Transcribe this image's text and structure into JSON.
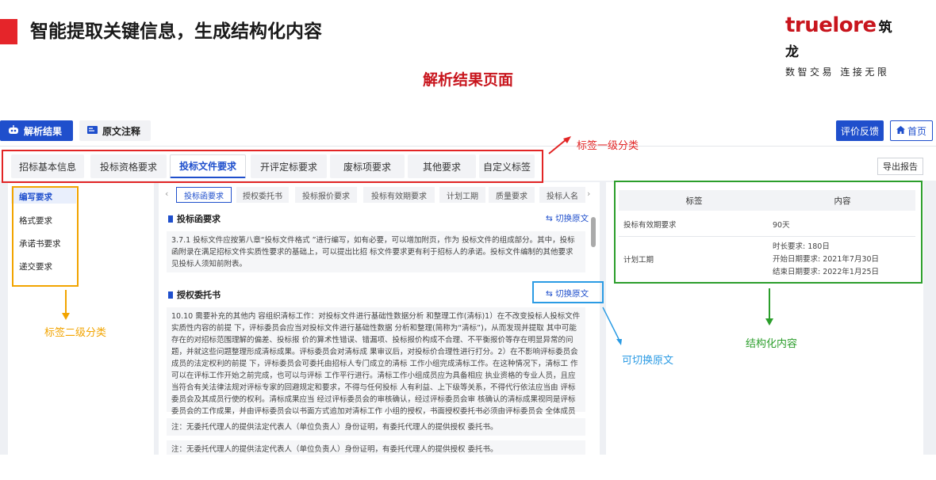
{
  "slide": {
    "title": "智能提取关键信息，生成结构化内容",
    "logo_main": "truelore",
    "logo_cn": "筑龙",
    "logo_sub": "数智交易 连接无限",
    "heading": "解析结果页面"
  },
  "topbar": {
    "parse_label": "解析结果",
    "annot_label": "原文注释",
    "feedback_label": "评价反馈",
    "home_label": "首页"
  },
  "tabs": [
    "招标基本信息",
    "投标资格要求",
    "投标文件要求",
    "开评定标要求",
    "废标项要求",
    "其他要求",
    "自定义标签"
  ],
  "export_label": "导出报告",
  "sidebar": [
    "编写要求",
    "格式要求",
    "承诺书要求",
    "递交要求"
  ],
  "subtabs": [
    "投标函要求",
    "授权委托书",
    "投标报价要求",
    "投标有效期要求",
    "计划工期",
    "质量要求",
    "投标人名"
  ],
  "sections": {
    "s1_title": "投标函要求",
    "s1_text": "3.7.1 投标文件应按第八章“投标文件格式 ”进行编写，如有必要，可以增加附页，作为 投标文件的组成部分。其中，投标函附录在满足招标文件实质性要求的基础上，可以提出比招 标文件要求更有利于招标人的承诺。投标文件编制的其他要求见投标人须知前附表。",
    "s2_title": "授权委托书",
    "s2_text": "10.10 需要补充的其他内 容组织清标工作：对投标文件进行基础性数据分析 和整理工作(清标)1）在不改变投标人投标文件实质性内容的前提 下，评标委员会应当对投标文件进行基础性数据 分析和整理(简称为“清标”)，从而发现并提取 其中可能存在的对招标范围理解的偏差、投标报 价的算术性错误、错漏项、投标报价构成不合理、不平衡报价等存在明显异常的问题，并就这些问题整理形成清标成果。评标委员会对清标成 果审议后，对投标价合理性进行打分。2）在不影响评标委员会成员的法定权利的前提 下，评标委员会可委托由招标人专门成立的清标 工作小组完成清标工作。在这种情况下，清标工 作可以在评标工作开始之前完成，也可以与评标 工作平行进行。清标工作小组成员应为具备相应 执业资格的专业人员，且应当符合有关法律法规对评标专家的回避规定和要求，不得与任何投标 人有利益、上下级等关系，不得代行依法应当由 评标委员会及其成员行使的权利。清标成果应当 经过评标委员会的审核确认，经过评标委员会审 核确认的清标成果视同是评标委员会的工作成果，并由评标委员会以书面方式追加对清标工作 小组的授权，书面授权委托书必须由评标委员会 全体成员签名。",
    "note1": "注：无委托代理人的提供法定代表人（单位负责人）身份证明，有委托代理人的提供授权 委托书。",
    "note2": "注：无委托代理人的提供法定代表人（单位负责人）身份证明，有委托代理人的提供授权 委托书。",
    "switch_label": "切换原文"
  },
  "table": {
    "head_tag": "标签",
    "head_content": "内容",
    "rows": [
      {
        "tag": "投标有效期要求",
        "content": [
          "90天"
        ]
      },
      {
        "tag": "计划工期",
        "content": [
          "时长要求: 180日",
          "开始日期要求: 2021年7月30日",
          "结束日期要求: 2022年1月25日"
        ]
      }
    ]
  },
  "annotations": {
    "level1": "标签一级分类",
    "level2": "标签二级分类",
    "switch": "可切换原文",
    "structured": "结构化内容"
  },
  "colors": {
    "accent": "#1f4fcc",
    "red": "#e22525",
    "orange": "#f2a400",
    "blue": "#2b9be4",
    "green": "#2b9e2b"
  }
}
